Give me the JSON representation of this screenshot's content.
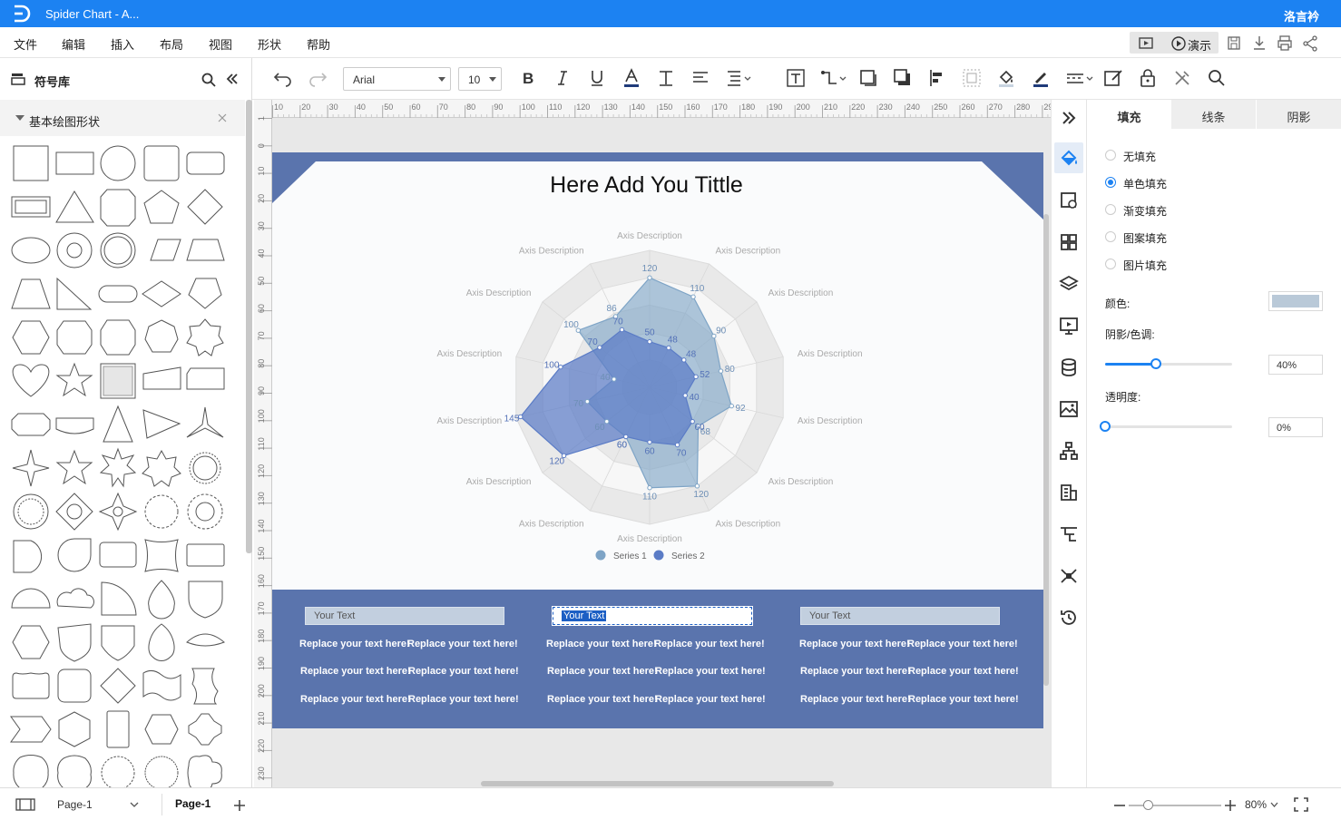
{
  "app": {
    "document_title": "Spider Chart - A...",
    "user_name": "洛言衿"
  },
  "menu": [
    "文件",
    "编辑",
    "插入",
    "布局",
    "视图",
    "形状",
    "帮助"
  ],
  "present_label": "演示",
  "toolbar": {
    "font_family": "Arial",
    "font_size": "10"
  },
  "library": {
    "title": "符号库",
    "category": "基本绘图形状"
  },
  "ruler_top": [
    "10",
    "20",
    "30",
    "40",
    "50",
    "60",
    "70",
    "80",
    "90",
    "100",
    "110",
    "120",
    "130",
    "140",
    "150",
    "160",
    "170",
    "180",
    "190",
    "200",
    "210",
    "220",
    "230",
    "240",
    "250",
    "260",
    "270",
    "280",
    "290"
  ],
  "ruler_left": [
    "1",
    "0",
    "10",
    "20",
    "30",
    "40",
    "50",
    "60",
    "70",
    "80",
    "90",
    "100",
    "110",
    "120",
    "130",
    "140",
    "150",
    "160",
    "170",
    "180",
    "190",
    "200",
    "210",
    "220",
    "230"
  ],
  "diagram": {
    "title": "Here Add You Tittle",
    "axis_label": "Axis Description",
    "text_boxes": [
      "Your Text",
      "Your Text",
      "Your Text"
    ],
    "replace_text": "Replace your text here!"
  },
  "chart_data": {
    "type": "radar",
    "categories": [
      "Axis Description",
      "Axis Description",
      "Axis Description",
      "Axis Description",
      "Axis Description",
      "Axis Description",
      "Axis Description",
      "Axis Description",
      "Axis Description",
      "Axis Description",
      "Axis Description",
      "Axis Description",
      "Axis Description",
      "Axis Description"
    ],
    "legend_position": "bottom",
    "series": [
      {
        "name": "Series 1",
        "color": "#7ea4c6",
        "values": [
          120,
          110,
          90,
          80,
          92,
          68,
          120,
          110,
          60,
          60,
          70,
          40,
          100,
          86
        ]
      },
      {
        "name": "Series 2",
        "color": "#5b7cc6",
        "values": [
          50,
          48,
          48,
          52,
          40,
          60,
          70,
          60,
          60,
          120,
          145,
          100,
          70,
          70
        ]
      }
    ],
    "rmax": 150
  },
  "right_panel": {
    "tabs": [
      "填充",
      "线条",
      "阴影"
    ],
    "fill_options": [
      "无填充",
      "单色填充",
      "渐变填充",
      "图案填充",
      "图片填充"
    ],
    "selected_fill": "单色填充",
    "color_label": "颜色:",
    "color_value": "#b9c9d8",
    "shade_label": "阴影/色调:",
    "shade_value": "40%",
    "shade_fraction": 0.4,
    "transparency_label": "透明度:",
    "transparency_value": "0%",
    "transparency_fraction": 0
  },
  "status": {
    "page_selector": "Page-1",
    "page_tab": "Page-1",
    "zoom": "80%"
  }
}
